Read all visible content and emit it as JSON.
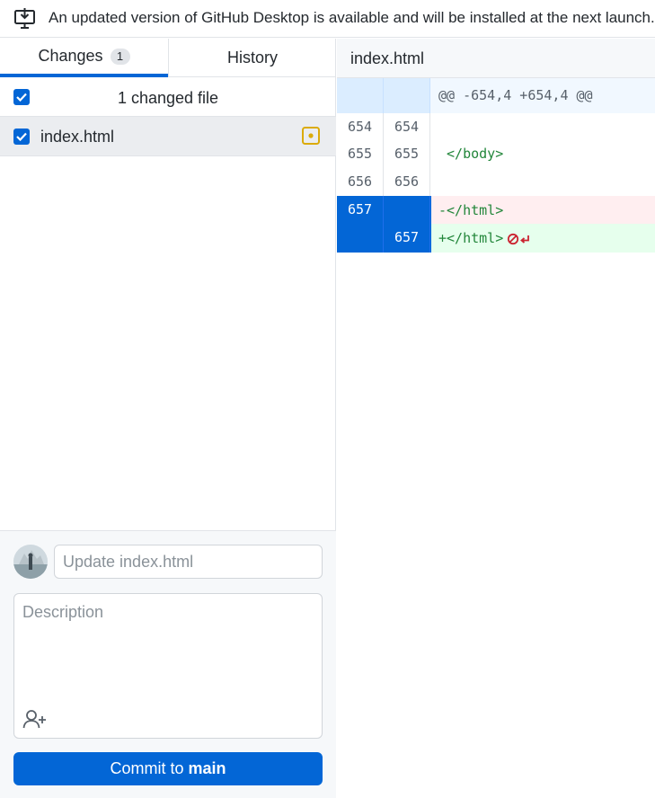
{
  "banner": {
    "message": "An updated version of GitHub Desktop is available and will be installed at the next launch.",
    "icon": "desktop-download-icon"
  },
  "tabs": [
    {
      "label": "Changes",
      "count": "1",
      "active": true
    },
    {
      "label": "History",
      "active": false
    }
  ],
  "changes": {
    "header_label": "1 changed file",
    "files": [
      {
        "name": "index.html",
        "checked": true,
        "status": "modified"
      }
    ]
  },
  "commit": {
    "summary_placeholder": "Update index.html",
    "description_placeholder": "Description",
    "button_prefix": "Commit to",
    "branch": "main",
    "coauthor_icon": "person-add-icon"
  },
  "diff": {
    "file_name": "index.html",
    "hunk_header": "@@ -654,4 +654,4 @@",
    "lines": [
      {
        "type": "context",
        "old": "654",
        "new": "654",
        "text": ""
      },
      {
        "type": "context",
        "old": "655",
        "new": "655",
        "text": " </body>"
      },
      {
        "type": "context",
        "old": "656",
        "new": "656",
        "text": ""
      },
      {
        "type": "deleted",
        "old": "657",
        "new": "",
        "text": "-</html>"
      },
      {
        "type": "added",
        "old": "",
        "new": "657",
        "text": "+</html>"
      }
    ]
  },
  "colors": {
    "accent": "#0366d6",
    "modified": "#dbab09",
    "deleted_bg": "#ffeef0",
    "added_bg": "#e6ffed",
    "no_newline": "#cb2431"
  }
}
